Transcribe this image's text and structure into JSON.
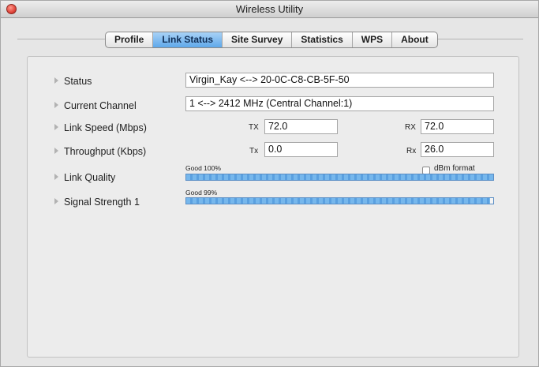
{
  "window": {
    "title": "Wireless Utility"
  },
  "tabs": [
    {
      "label": "Profile",
      "active": false
    },
    {
      "label": "Link Status",
      "active": true
    },
    {
      "label": "Site Survey",
      "active": false
    },
    {
      "label": "Statistics",
      "active": false
    },
    {
      "label": "WPS",
      "active": false
    },
    {
      "label": "About",
      "active": false
    }
  ],
  "status": {
    "label": "Status",
    "value": "Virgin_Kay <--> 20-0C-C8-CB-5F-50"
  },
  "channel": {
    "label": "Current Channel",
    "value": "1 <--> 2412 MHz (Central Channel:1)"
  },
  "link_speed": {
    "label": "Link Speed (Mbps)",
    "tx_label": "TX",
    "tx_value": "72.0",
    "rx_label": "RX",
    "rx_value": "72.0"
  },
  "throughput": {
    "label": "Throughput (Kbps)",
    "tx_label": "Tx",
    "tx_value": "0.0",
    "rx_label": "Rx",
    "rx_value": "26.0"
  },
  "link_quality": {
    "label": "Link Quality",
    "text": "Good 100%",
    "percent": 100
  },
  "dbm_format": {
    "label": "dBm format",
    "checked": false
  },
  "signal_strength": {
    "label": "Signal Strength 1",
    "text": "Good 99%",
    "percent": 99
  },
  "colors": {
    "active_tab": "#5fa8ea",
    "progress_bar": "#76b7ec",
    "close_button": "#e0443a"
  },
  "icons": {
    "close": "close-icon",
    "row_marker": "triangle-right-icon"
  }
}
